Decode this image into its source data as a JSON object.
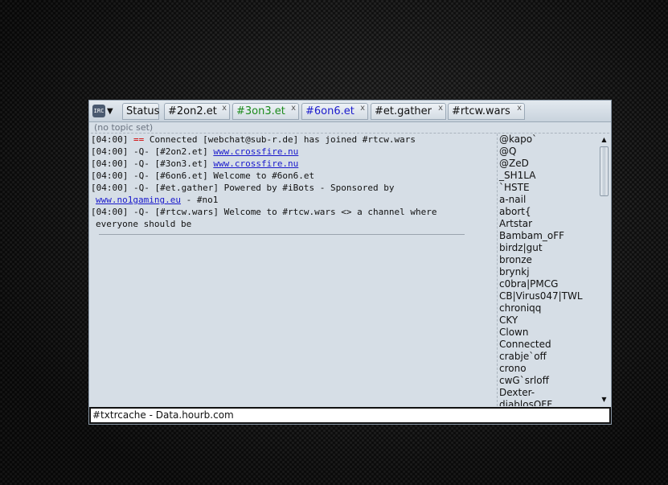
{
  "menu": {
    "logo_text": "IRC",
    "caret": "▼"
  },
  "tabs": [
    {
      "label": "Status",
      "color": "#111111",
      "closable": false
    },
    {
      "label": "#2on2.et",
      "color": "#111111",
      "closable": true
    },
    {
      "label": "#3on3.et",
      "color": "#1a8a1a",
      "closable": true
    },
    {
      "label": "#6on6.et",
      "color": "#1a1acc",
      "closable": true
    },
    {
      "label": "#et.gather",
      "color": "#111111",
      "closable": true
    },
    {
      "label": "#rtcw.wars",
      "color": "#111111",
      "closable": true
    }
  ],
  "close_glyph": "x",
  "topic": "(no topic set)",
  "log": [
    {
      "time": "[04:00]",
      "prefix": "==",
      "prefix_color": "#d40000",
      "text": " Connected [webchat@sub-r.de] has joined #rtcw.wars",
      "link": "",
      "after": "",
      "cont": ""
    },
    {
      "time": "[04:00]",
      "prefix": "-Q-",
      "prefix_color": "#111111",
      "text": " [#2on2.et] ",
      "link": "www.crossfire.nu",
      "after": "",
      "cont": ""
    },
    {
      "time": "[04:00]",
      "prefix": "-Q-",
      "prefix_color": "#111111",
      "text": " [#3on3.et] ",
      "link": "www.crossfire.nu",
      "after": "",
      "cont": ""
    },
    {
      "time": "[04:00]",
      "prefix": "-Q-",
      "prefix_color": "#111111",
      "text": " [#6on6.et] Welcome to #6on6.et",
      "link": "",
      "after": "",
      "cont": ""
    },
    {
      "time": "[04:00]",
      "prefix": "-Q-",
      "prefix_color": "#111111",
      "text": " [#et.gather] Powered by #iBots - Sponsored by",
      "link": "",
      "after": "",
      "cont_link": "www.no1gaming.eu",
      "cont": " - #no1"
    },
    {
      "time": "[04:00]",
      "prefix": "-Q-",
      "prefix_color": "#111111",
      "text": " [#rtcw.wars] Welcome to #rtcw.wars <> a channel where",
      "link": "",
      "after": "",
      "cont": "everyone should be"
    }
  ],
  "users": [
    "@kapo`",
    "@Q",
    "@ZeD",
    "_SH1LA",
    "`HSTE",
    "a-nail",
    "abort{",
    "Artstar",
    "Bambam_oFF",
    "birdz|gut",
    "bronze",
    "brynkj",
    "c0bra|PMCG",
    "CB|Virus047|TWL",
    "chroniqq",
    "CKY",
    "Clown",
    "Connected",
    "crabje`off",
    "crono",
    "cwG`srloff",
    "Dexter-",
    "diablosOFF"
  ],
  "scrollbar": {
    "up": "▲",
    "down": "▼"
  },
  "input": {
    "value": "#txtrcache - Data.hourb.com"
  }
}
